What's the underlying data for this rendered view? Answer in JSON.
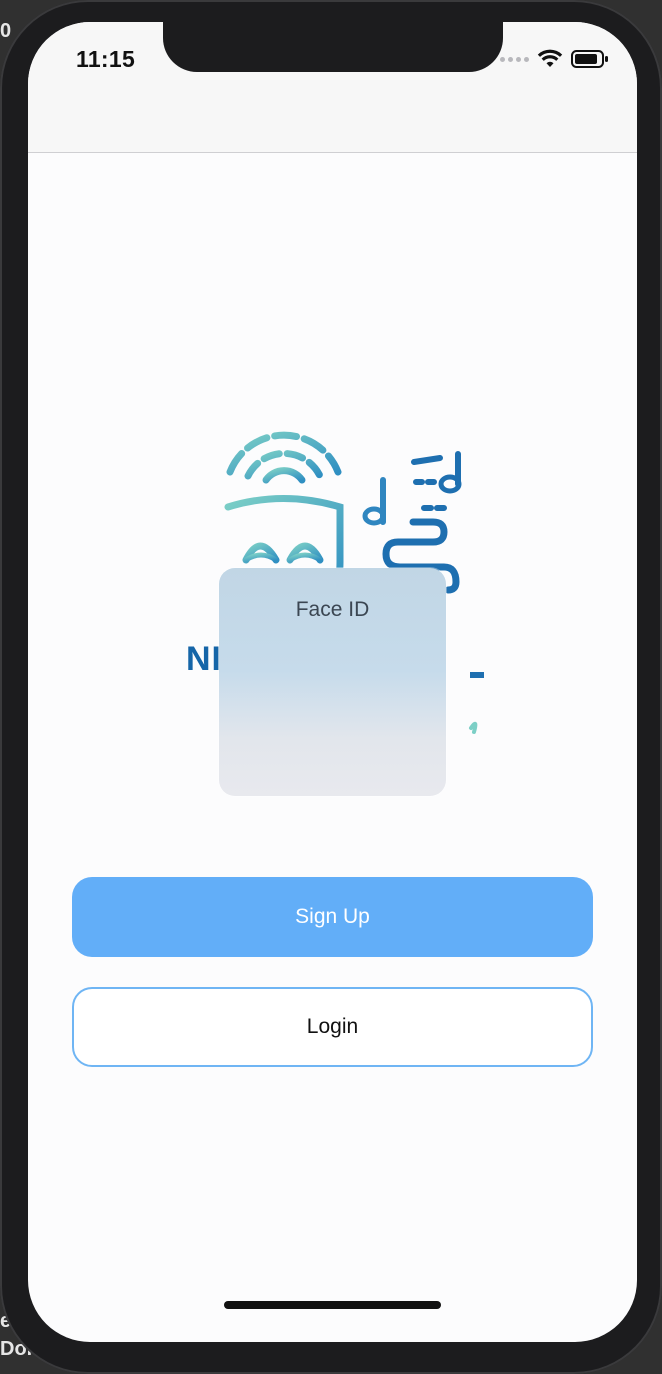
{
  "status_bar": {
    "time": "11:15"
  },
  "background_fragments": {
    "top_left": "0",
    "bottom_left_1": "e",
    "bottom_left_2": "Doi"
  },
  "logo": {
    "brand_visible_text": "NI",
    "icons": [
      "theater-mask-icon",
      "sound-wave-icon",
      "music-note-icon"
    ]
  },
  "face_id_dialog": {
    "title": "Face ID"
  },
  "actions": {
    "signup_label": "Sign Up",
    "login_label": "Login"
  },
  "colors": {
    "primary": "#62aef8",
    "login_border": "#6fb5f4",
    "logo_teal": "#6cc3c0",
    "logo_blue": "#1565a8"
  }
}
